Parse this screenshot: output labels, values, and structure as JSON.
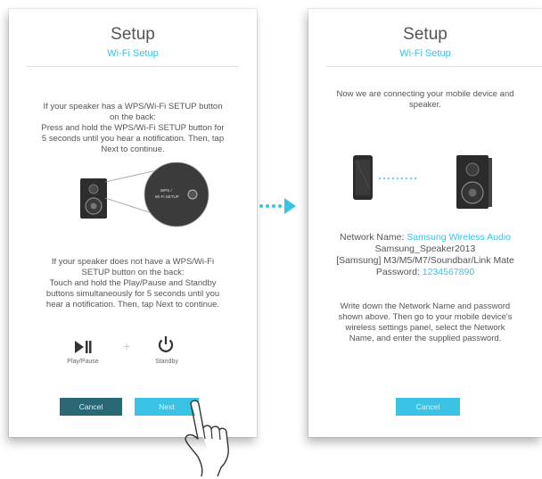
{
  "left_screen": {
    "title": "Setup",
    "subtitle": "Wi-Fi Setup",
    "wps_instructions": [
      "If your speaker has a WPS/Wi-Fi SETUP button",
      "on the back:",
      "Press and hold the WPS/Wi-Fi SETUP button for",
      "5 seconds until you hear a notification. Then, tap",
      "Next to continue."
    ],
    "button_label": "WPS /\nWi-Fi SETUP",
    "no_wps_instructions": [
      "If your speaker does not have a WPS/Wi-Fi",
      "SETUP button on the back:",
      "Touch and hold the Play/Pause and Standby",
      "buttons simultaneously for 5 seconds until you",
      "hear a notification. Then, tap Next to continue."
    ],
    "play_pause_label": "Play/Pause",
    "plus_sign": "+",
    "standby_label": "Standby",
    "cancel_label": "Cancel",
    "next_label": "Next"
  },
  "right_screen": {
    "title": "Setup",
    "subtitle": "Wi-Fi Setup",
    "connecting_text": [
      "Now we are connecting your mobile device and",
      "speaker."
    ],
    "network_name_label": "Network Name:",
    "network_names": [
      "Samsung Wireless Audio",
      "Samsung_Speaker2013",
      "[Samsung] M3/M5/M7/Soundbar/Link Mate"
    ],
    "password_label": "Password:",
    "password_value": "1234567890",
    "instructions": [
      "Write down the Network Name and password",
      "shown above. Then go to your mobile device's",
      "wireless settings panel, select the Network",
      "Name, and enter the supplied password."
    ],
    "cancel_label": "Cancel"
  },
  "colors": {
    "accent": "#3bc3e6",
    "dark_button": "#2a6875",
    "text": "#555555"
  },
  "icons": [
    "arrow-right-icon",
    "speaker-icon",
    "phone-icon",
    "play-pause-icon",
    "power-icon",
    "hand-pointer-icon"
  ]
}
